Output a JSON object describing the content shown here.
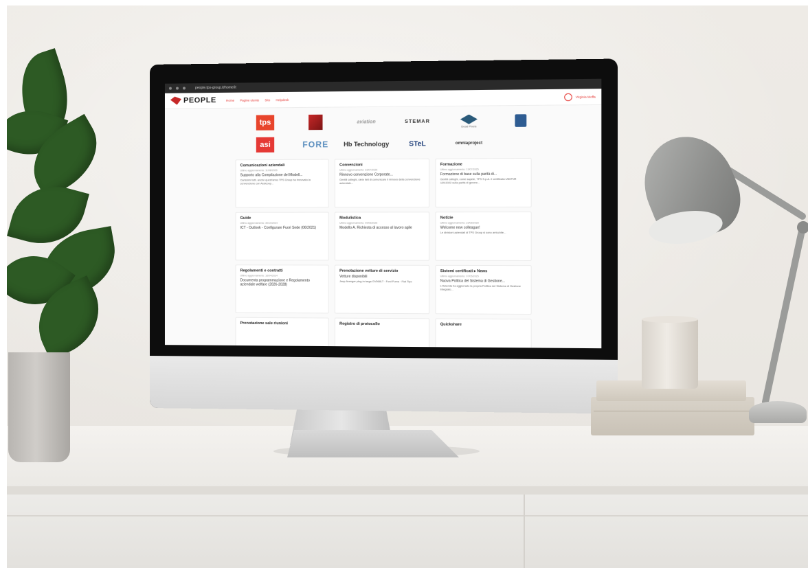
{
  "browser": {
    "url": "people.tps-group.it/home/it"
  },
  "app": {
    "brand": "PEOPLE",
    "nav": [
      "Home",
      "Pagine utente",
      "Sito",
      "Helpdesk"
    ],
    "user": "Virginia Moffa"
  },
  "logos": [
    {
      "name": "tps",
      "text": "tps"
    },
    {
      "name": "red-mark",
      "text": ""
    },
    {
      "name": "aviation",
      "text": "aviation"
    },
    {
      "name": "stemar",
      "text": "STEMAR"
    },
    {
      "name": "dead-pixels",
      "text": "Dead Pixels"
    },
    {
      "name": "cube",
      "text": ""
    },
    {
      "name": "asi",
      "text": "asi"
    },
    {
      "name": "fore",
      "text": "FORE"
    },
    {
      "name": "hb",
      "text": "Hb Technology"
    },
    {
      "name": "stel",
      "text": "STeL"
    },
    {
      "name": "omnia",
      "text": "omniaproject"
    }
  ],
  "cards": [
    {
      "title": "Comunicazioni aziendali",
      "meta": "Ultimo aggiornamento: 11/08/2025",
      "head": "Supporto alla Compilazione del Modell...",
      "body": "Carissimi tutti, anche quest'anno TPS Group ha rinnovato la convenzione con Assicoop..."
    },
    {
      "title": "Convenzioni",
      "meta": "Ultimo aggiornamento: 23/07/2025",
      "head": "Rinnovo convenzione Corporate...",
      "body": "Gentili colleghi, siete lieti di comunicare il rinnovo della convenzione aziendale..."
    },
    {
      "title": "Formazione",
      "meta": "Ultimo aggiornamento: 13/07/2025",
      "head": "Formazione di base sulla parità di...",
      "body": "Gentili colleghi, come sapete, TPS S.p.A. è certificata UNI/PdR 125:2022 sulla parità di genere..."
    },
    {
      "title": "Guide",
      "meta": "Ultimo aggiornamento: 30/10/2024",
      "head": "ICT - Outlook - Configurare Fuori Sede (06/2021)",
      "body": ""
    },
    {
      "title": "Modulistica",
      "meta": "Ultimo aggiornamento: 09/05/2025",
      "head": "Modello A. Richiesta di accesso al lavoro agile",
      "body": ""
    },
    {
      "title": "Notizie",
      "meta": "Ultimo aggiornamento: 23/05/2025",
      "head": "Welcome new colleague!",
      "body": "Le divisioni aziendali di TPS Group si sono arricchite..."
    },
    {
      "title": "Regolamenti e contratti",
      "meta": "Ultimo aggiornamento: 16/04/2024",
      "head": "Documenta programmazione e Regolamento aziendale welfare (2026-2028)",
      "body": ""
    },
    {
      "title": "Prenotazione vetture di servizio",
      "meta": "",
      "head": "Vetture disponibili",
      "body": "Jeep Avenger plug-in targa GV568LT · Ford Puma · Fiat Tipo"
    },
    {
      "title": "Sistemi certificati ▸ News",
      "meta": "Ultimo aggiornamento: 07/05/2025",
      "head": "Nuova Politica del Sistema di Gestione...",
      "body": "L'Azienda ha aggiornato la propria Politica del Sistema di Gestione Integrato..."
    },
    {
      "title": "Prenotazione sale riunioni",
      "meta": "",
      "head": "",
      "body": ""
    },
    {
      "title": "Registro di protocollo",
      "meta": "",
      "head": "",
      "body": ""
    },
    {
      "title": "Quickshare",
      "meta": "",
      "head": "",
      "body": ""
    }
  ]
}
